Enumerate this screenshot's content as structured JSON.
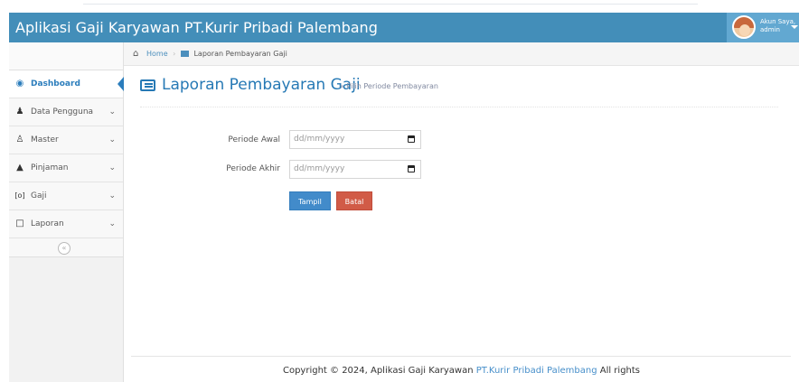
{
  "navbar": {
    "brand": "Aplikasi Gaji Karyawan PT.Kurir Pribadi Palembang",
    "user_greeting": "Akun Saya,",
    "user_name": "admin"
  },
  "sidebar": {
    "items": [
      {
        "label": "Dashboard",
        "icon": "dashboard-icon",
        "active": true
      },
      {
        "label": "Data Pengguna",
        "icon": "user-icon",
        "has_submenu": true
      },
      {
        "label": "Master",
        "icon": "group-icon",
        "has_submenu": true
      },
      {
        "label": "Pinjaman",
        "icon": "book-icon",
        "has_submenu": true
      },
      {
        "label": "Gaji",
        "icon": "money-icon",
        "has_submenu": true
      },
      {
        "label": "Laporan",
        "icon": "file-icon",
        "has_submenu": true
      }
    ],
    "collapse_glyph": "«"
  },
  "breadcrumb": {
    "home": "Home",
    "current": "Laporan Pembayaran Gaji"
  },
  "page_header": {
    "title": "Laporan Pembayaran Gaji",
    "subtitle": "» Pilih Periode Pembayaran"
  },
  "form": {
    "periode_awal_label": "Periode Awal",
    "periode_awal_placeholder": "dd/mm/yyyy",
    "periode_akhir_label": "Periode Akhir",
    "periode_akhir_placeholder": "dd/mm/yyyy",
    "submit_label": "Tampil",
    "cancel_label": "Batal"
  },
  "footer": {
    "prefix": "Copyright © 2024, Aplikasi Gaji Karyawan",
    "company": "PT.Kurir Pribadi Palembang",
    "suffix": "All rights"
  },
  "colors": {
    "navbar": "#438eb9",
    "accent": "#2679b5",
    "primary_button": "#428bca",
    "danger_button": "#d15b47"
  }
}
